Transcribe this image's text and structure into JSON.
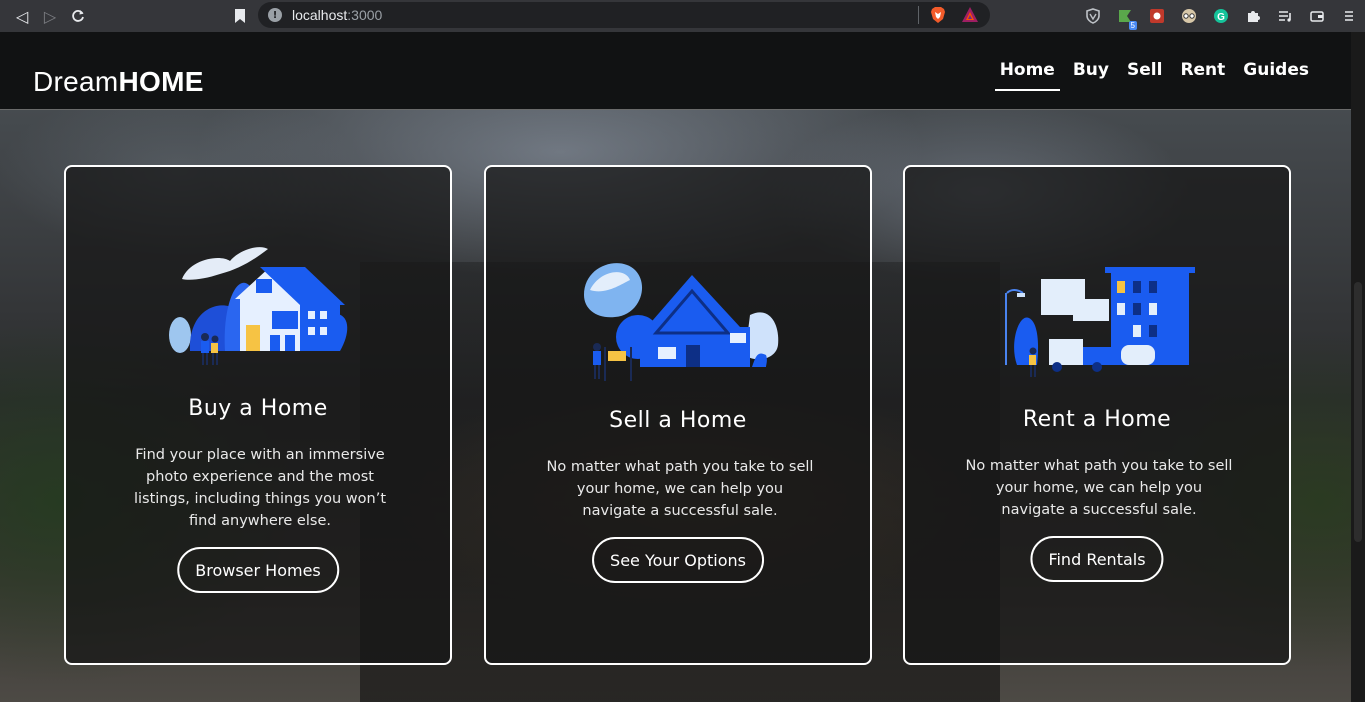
{
  "browser": {
    "url_host": "localhost",
    "url_port": ":3000",
    "extension_badge": "5"
  },
  "site": {
    "logo_light": "Dream",
    "logo_bold": "HOME",
    "nav": [
      "Home",
      "Buy",
      "Sell",
      "Rent",
      "Guides"
    ],
    "active_nav": "Home"
  },
  "cards": [
    {
      "title": "Buy a Home",
      "description": "Find your place with an immersive photo experience and the most listings, including things you won’t find anywhere else.",
      "button": "Browser Homes"
    },
    {
      "title": "Sell a Home",
      "description": "No matter what path you take to sell your home, we can help you navigate a successful sale.",
      "button": "See Your Options"
    },
    {
      "title": "Rent a Home",
      "description": "No matter what path you take to sell your home, we can help you navigate a successful sale.",
      "button": "Find Rentals"
    }
  ],
  "colors": {
    "accent_blue": "#1a5cf0",
    "card_border": "#ffffff",
    "navbar_bg": "#111213"
  }
}
